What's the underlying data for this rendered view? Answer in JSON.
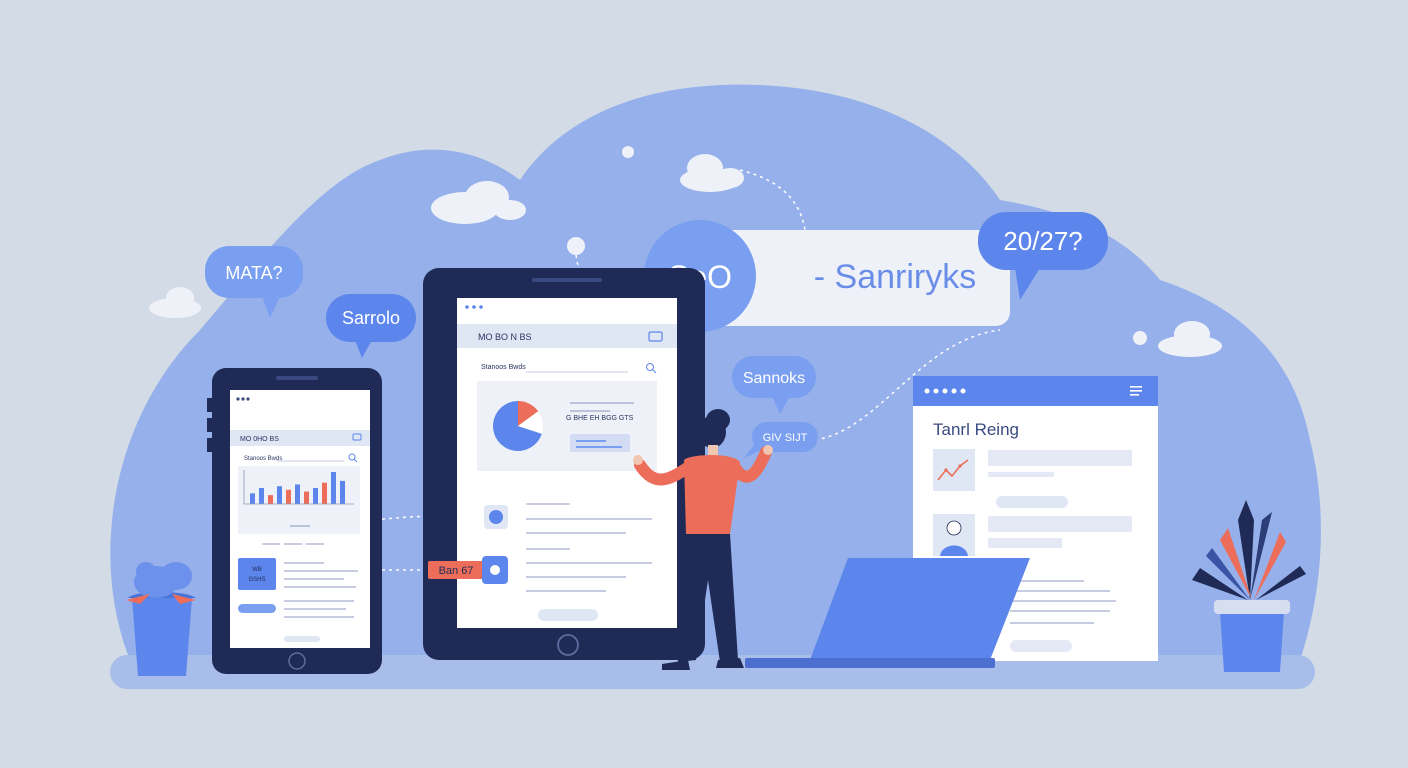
{
  "colors": {
    "background": "#d3dbe6",
    "blob": "#8aa8ea",
    "accent_blue": "#5d86ec",
    "navy": "#1f2a56",
    "coral": "#ec6e5a",
    "bubble": "#7a9ff0"
  },
  "bubbles": {
    "mata": "MATA?",
    "sarrolo": "Sarrolo",
    "seo": "SeO",
    "date": "20/27?",
    "sannoks": "Sannoks",
    "small": "GIV SIJT"
  },
  "search_bar": {
    "text": "- Sanriryks"
  },
  "phone": {
    "header": "MO 0HO BS",
    "search_label": "Stanoos Bwds",
    "card_text": "WB\nGSHS",
    "chart_data": {
      "type": "bar",
      "categories": [
        "1",
        "2",
        "3",
        "4",
        "5",
        "6",
        "7",
        "8",
        "9",
        "10",
        "11"
      ],
      "values": [
        30,
        45,
        25,
        50,
        40,
        55,
        35,
        45,
        60,
        90,
        65
      ]
    }
  },
  "tablet": {
    "header": "MO BO N BS",
    "search_label": "Stanoos Bwds",
    "card_text": "G BHE EH BGG GTS",
    "pie_data": {
      "type": "pie",
      "values": [
        70,
        15,
        15
      ]
    }
  },
  "tag": {
    "text": "Ban 67"
  },
  "browser": {
    "title": "Tanrl Reing"
  },
  "icons": [
    "cloud-icon",
    "chart-icon",
    "user-icon",
    "plant-icon",
    "laptop-icon",
    "pie-chart-icon",
    "search-icon"
  ]
}
